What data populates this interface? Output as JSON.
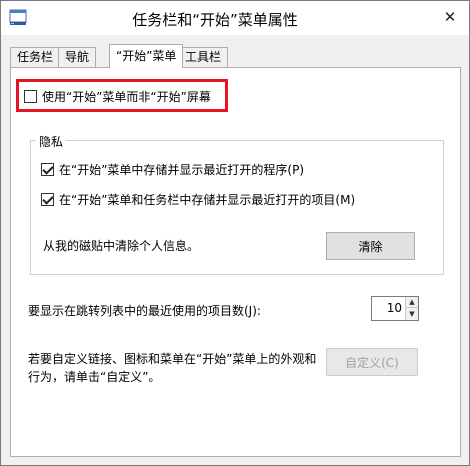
{
  "window": {
    "title": "任务栏和“开始”菜单属性"
  },
  "tabs": [
    {
      "label": "任务栏"
    },
    {
      "label": "导航"
    },
    {
      "label": "“开始”菜单"
    },
    {
      "label": "工具栏"
    }
  ],
  "start_screen": {
    "checkbox_label": "使用“开始”菜单而非“开始”屏幕",
    "checked": false
  },
  "privacy": {
    "legend": "隐私",
    "store_programs_label": "在“开始”菜单中存储并显示最近打开的程序(P)",
    "store_items_label": "在“开始”菜单和任务栏中存储并显示最近打开的项目(M)",
    "clear_info_text": "从我的磁贴中清除个人信息。",
    "clear_button": "清除"
  },
  "jumplist": {
    "label": "要显示在跳转列表中的最近使用的项目数(J):",
    "value": "10"
  },
  "customize": {
    "text_line1": "若要自定义链接、图标和菜单在“开始”菜单上的外观和",
    "text_line2": "行为，请单击“自定义”。",
    "button": "自定义(C)"
  },
  "colors": {
    "highlight": "#e6141e"
  }
}
